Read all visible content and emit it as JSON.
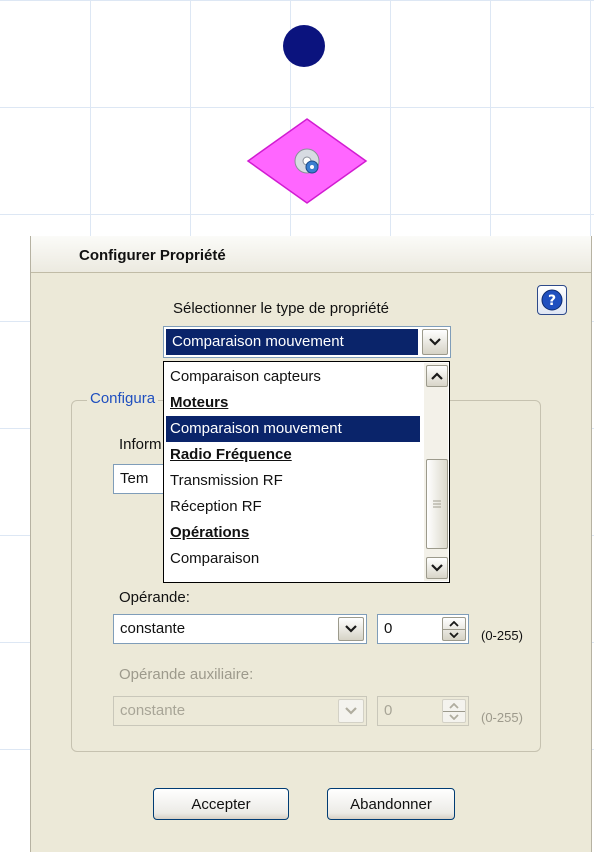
{
  "canvas": {
    "node_circle_color": "#0b137e",
    "node_diamond_color": "#ff66ff",
    "node_diamond_icon": "disc-icon"
  },
  "dialog": {
    "title": "Configurer Propriété",
    "help_icon": "help-icon",
    "type_label": "Sélectionner le type de propriété",
    "type_selected": "Comparaison mouvement",
    "type_options": [
      {
        "label": "Comparaison capteurs",
        "group": false,
        "selected": false
      },
      {
        "label": "Moteurs",
        "group": true,
        "selected": false
      },
      {
        "label": "Comparaison mouvement",
        "group": false,
        "selected": true
      },
      {
        "label": "Radio Fréquence",
        "group": true,
        "selected": false
      },
      {
        "label": "Transmission RF",
        "group": false,
        "selected": false
      },
      {
        "label": "Réception RF",
        "group": false,
        "selected": false
      },
      {
        "label": "Opérations",
        "group": true,
        "selected": false
      },
      {
        "label": "Comparaison",
        "group": false,
        "selected": false
      }
    ],
    "config_legend": "Configura",
    "info_label": "Inform",
    "info_value": "Tem",
    "operand_label": "Opérande:",
    "operand_value": "constante",
    "operand_number": "0",
    "operand_range": "(0-255)",
    "aux_label": "Opérande auxiliaire:",
    "aux_value": "constante",
    "aux_number": "0",
    "aux_range": "(0-255)",
    "accept_label": "Accepter",
    "cancel_label": "Abandonner"
  }
}
